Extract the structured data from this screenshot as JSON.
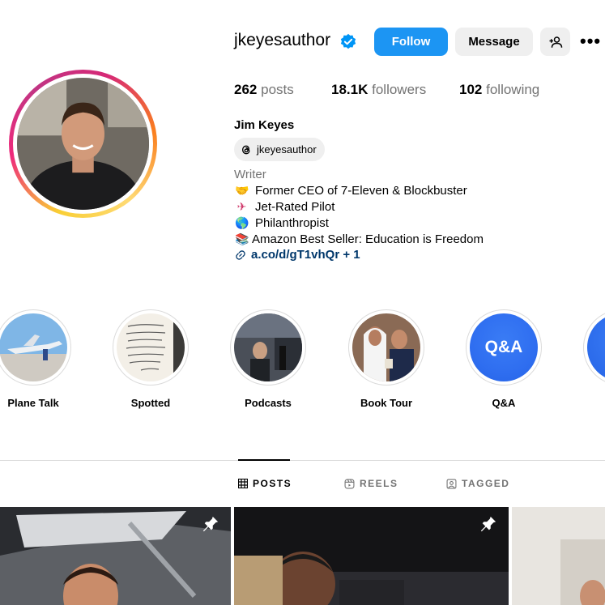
{
  "profile": {
    "username": "jkeyesauthor",
    "verified": true,
    "follow_label": "Follow",
    "message_label": "Message",
    "posts_count": "262",
    "posts_label": "posts",
    "followers_count": "18.1K",
    "followers_label": "followers",
    "following_count": "102",
    "following_label": "following",
    "full_name": "Jim Keyes",
    "threads_handle": "jkeyesauthor",
    "category": "Writer",
    "bio": [
      {
        "emoji": "🤝",
        "text": "Former CEO of 7-Eleven & Blockbuster"
      },
      {
        "emoji": "✈",
        "text": "Jet-Rated Pilot"
      },
      {
        "emoji": "🌎",
        "text": "Philanthropist"
      },
      {
        "emoji": "📚",
        "text": "Amazon Best Seller: Education is Freedom"
      }
    ],
    "link": "a.co/d/gT1vhQr + 1"
  },
  "highlights": [
    {
      "label": "Plane Talk"
    },
    {
      "label": "Spotted"
    },
    {
      "label": "Podcasts"
    },
    {
      "label": "Book Tour"
    },
    {
      "label": "Q&A",
      "cover_text": "Q&A"
    }
  ],
  "tabs": {
    "posts": "POSTS",
    "reels": "REELS",
    "tagged": "TAGGED"
  },
  "colors": {
    "accent": "#1c95f3",
    "link": "#00376b",
    "secondary_text": "#737373"
  }
}
